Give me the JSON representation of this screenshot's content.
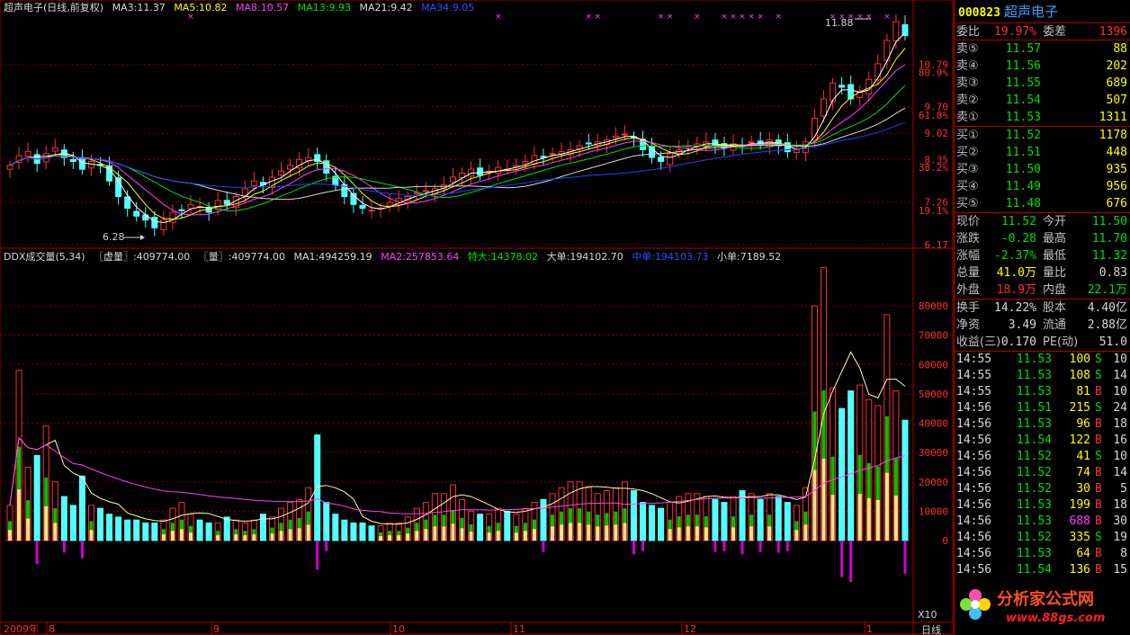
{
  "chart": {
    "price_header": {
      "title": "超声电子(日线,前复权)",
      "ma3": "MA3:11.37",
      "ma5": "MA5:10.82",
      "ma8": "MA8:10.57",
      "ma13": "MA13:9.93",
      "ma21": "MA21:9.42",
      "ma34": "MA34:9.05"
    },
    "price_axis": [
      "10.79",
      "80.9%",
      "9.70",
      "61.8%",
      "9.02",
      "8.35",
      "38.2%",
      "7.26",
      "19.1%",
      "6.17"
    ],
    "high_label": "11.88",
    "low_label": "6.28",
    "volume_header": {
      "title": "DDX成交量(5,34)",
      "xuliang": "〖虚量〗:409774.00",
      "liang": "〖量〗:409774.00",
      "ma1": "MA1:494259.19",
      "ma2": "MA2:257853.64",
      "tedan": "特大:14378.02",
      "dadan": "大单:194102.70",
      "zhongdan": "中单:194103.73",
      "xiaodan": "小单:7189.52"
    },
    "volume_axis": [
      "80000",
      "70000",
      "60000",
      "50000",
      "40000",
      "30000",
      "20000",
      "10000",
      "0"
    ],
    "volume_unit": "X10",
    "date_axis": [
      "2009年",
      "8",
      "9",
      "10",
      "11",
      "12",
      "1"
    ],
    "period": "日线",
    "watermark": "分析家公式网",
    "watermark_url": "www.88gs.com"
  },
  "quote": {
    "code": "000823",
    "name": "超声电子",
    "weibi_label": "委比",
    "weibi": "19.97%",
    "weicha_label": "委差",
    "weicha": "1396",
    "asks": [
      {
        "label": "卖⑤",
        "price": "11.57",
        "vol": "88"
      },
      {
        "label": "卖④",
        "price": "11.56",
        "vol": "202"
      },
      {
        "label": "卖③",
        "price": "11.55",
        "vol": "689"
      },
      {
        "label": "卖②",
        "price": "11.54",
        "vol": "507"
      },
      {
        "label": "卖①",
        "price": "11.53",
        "vol": "1311"
      }
    ],
    "bids": [
      {
        "label": "买①",
        "price": "11.52",
        "vol": "1178"
      },
      {
        "label": "买②",
        "price": "11.51",
        "vol": "448"
      },
      {
        "label": "买③",
        "price": "11.50",
        "vol": "935"
      },
      {
        "label": "买④",
        "price": "11.49",
        "vol": "956"
      },
      {
        "label": "买⑤",
        "price": "11.48",
        "vol": "676"
      }
    ],
    "stats": [
      {
        "l1": "现价",
        "v1": "11.52",
        "l2": "今开",
        "v2": "11.50"
      },
      {
        "l1": "涨跌",
        "v1": "-0.28",
        "l2": "最高",
        "v2": "11.70"
      },
      {
        "l1": "涨幅",
        "v1": "-2.37%",
        "l2": "最低",
        "v2": "11.32"
      },
      {
        "l1": "总量",
        "v1": "41.0万",
        "l2": "量比",
        "v2": "0.83"
      },
      {
        "l1": "外盘",
        "v1": "18.9万",
        "l2": "内盘",
        "v2": "22.1万"
      }
    ],
    "fund": [
      {
        "l1": "换手",
        "v1": "14.22%",
        "l2": "股本",
        "v2": "4.40亿"
      },
      {
        "l1": "净资",
        "v1": "3.49",
        "l2": "流通",
        "v2": "2.88亿"
      },
      {
        "l1": "收益(三)",
        "v1": "0.170",
        "l2": "PE(动)",
        "v2": "51.0"
      }
    ],
    "ticks": [
      {
        "t": "14:55",
        "p": "11.53",
        "v": "100",
        "s": "S",
        "n": "10"
      },
      {
        "t": "14:55",
        "p": "11.53",
        "v": "108",
        "s": "S",
        "n": "14"
      },
      {
        "t": "14:55",
        "p": "11.53",
        "v": "81",
        "s": "B",
        "n": "10"
      },
      {
        "t": "14:56",
        "p": "11.51",
        "v": "215",
        "s": "S",
        "n": "24"
      },
      {
        "t": "14:56",
        "p": "11.53",
        "v": "96",
        "s": "B",
        "n": "18"
      },
      {
        "t": "14:56",
        "p": "11.54",
        "v": "122",
        "s": "B",
        "n": "16"
      },
      {
        "t": "14:56",
        "p": "11.52",
        "v": "41",
        "s": "S",
        "n": "10"
      },
      {
        "t": "14:56",
        "p": "11.52",
        "v": "74",
        "s": "B",
        "n": "14"
      },
      {
        "t": "14:56",
        "p": "11.52",
        "v": "30",
        "s": "B",
        "n": "5"
      },
      {
        "t": "14:56",
        "p": "11.53",
        "v": "199",
        "s": "B",
        "n": "18"
      },
      {
        "t": "14:56",
        "p": "11.53",
        "v": "688",
        "s": "B",
        "n": "30"
      },
      {
        "t": "14:56",
        "p": "11.52",
        "v": "335",
        "s": "S",
        "n": "19"
      },
      {
        "t": "14:56",
        "p": "11.53",
        "v": "64",
        "s": "B",
        "n": "8"
      },
      {
        "t": "14:56",
        "p": "11.54",
        "v": "136",
        "s": "B",
        "n": "15"
      }
    ]
  },
  "chart_data": {
    "type": "candlestick",
    "price_series": [
      8.2,
      8.45,
      8.55,
      8.25,
      8.5,
      8.65,
      8.4,
      8.3,
      8.1,
      8.3,
      8.2,
      7.8,
      7.4,
      7.1,
      6.9,
      6.8,
      6.6,
      6.8,
      7.0,
      7.05,
      7.2,
      7.15,
      7.0,
      7.3,
      7.2,
      7.4,
      7.6,
      7.8,
      7.7,
      7.9,
      8.05,
      8.2,
      8.35,
      8.4,
      8.3,
      8.0,
      7.7,
      7.4,
      7.2,
      7.1,
      7.05,
      7.1,
      7.25,
      7.35,
      7.4,
      7.5,
      7.55,
      7.6,
      7.7,
      7.9,
      8.0,
      8.1,
      7.95,
      8.05,
      8.15,
      8.1,
      8.2,
      8.3,
      8.45,
      8.4,
      8.5,
      8.55,
      8.6,
      8.7,
      8.75,
      8.8,
      8.85,
      8.95,
      9.0,
      8.9,
      8.6,
      8.4,
      8.3,
      8.5,
      8.6,
      8.7,
      8.75,
      8.8,
      8.7,
      8.65,
      8.75,
      8.7,
      8.8,
      8.75,
      8.85,
      8.7,
      8.55,
      8.6,
      8.8,
      9.4,
      9.9,
      10.3,
      10.2,
      9.9,
      10.1,
      10.4,
      10.8,
      11.4,
      11.88,
      11.52
    ],
    "volume_series": [
      1.2,
      5.8,
      2.5,
      2.9,
      3.9,
      2.0,
      1.5,
      1.2,
      2.2,
      1.2,
      1.1,
      0.9,
      0.8,
      0.7,
      0.7,
      0.6,
      0.6,
      0.7,
      1.1,
      1.3,
      0.9,
      0.7,
      0.6,
      0.6,
      0.8,
      0.7,
      0.6,
      0.7,
      0.9,
      0.8,
      1.1,
      1.3,
      1.4,
      1.8,
      3.6,
      1.3,
      0.9,
      0.7,
      0.6,
      0.6,
      0.5,
      0.5,
      0.6,
      0.6,
      0.8,
      1.1,
      1.3,
      1.6,
      1.6,
      1.9,
      1.4,
      1.0,
      0.9,
      0.9,
      1.1,
      1.0,
      0.9,
      1.1,
      1.3,
      1.4,
      1.6,
      1.8,
      2.0,
      2.0,
      1.8,
      1.6,
      1.7,
      1.8,
      2.0,
      1.7,
      1.3,
      1.2,
      1.1,
      1.3,
      1.5,
      1.6,
      1.6,
      1.5,
      1.4,
      1.3,
      1.5,
      1.7,
      1.6,
      1.4,
      1.6,
      1.5,
      1.3,
      1.2,
      1.8,
      8.0,
      9.3,
      5.2,
      4.5,
      5.1,
      5.3,
      4.8,
      4.6,
      7.7,
      5.1,
      4.1
    ],
    "price_range": [
      6.17,
      11.88
    ],
    "volume_range": [
      0,
      90000
    ]
  }
}
